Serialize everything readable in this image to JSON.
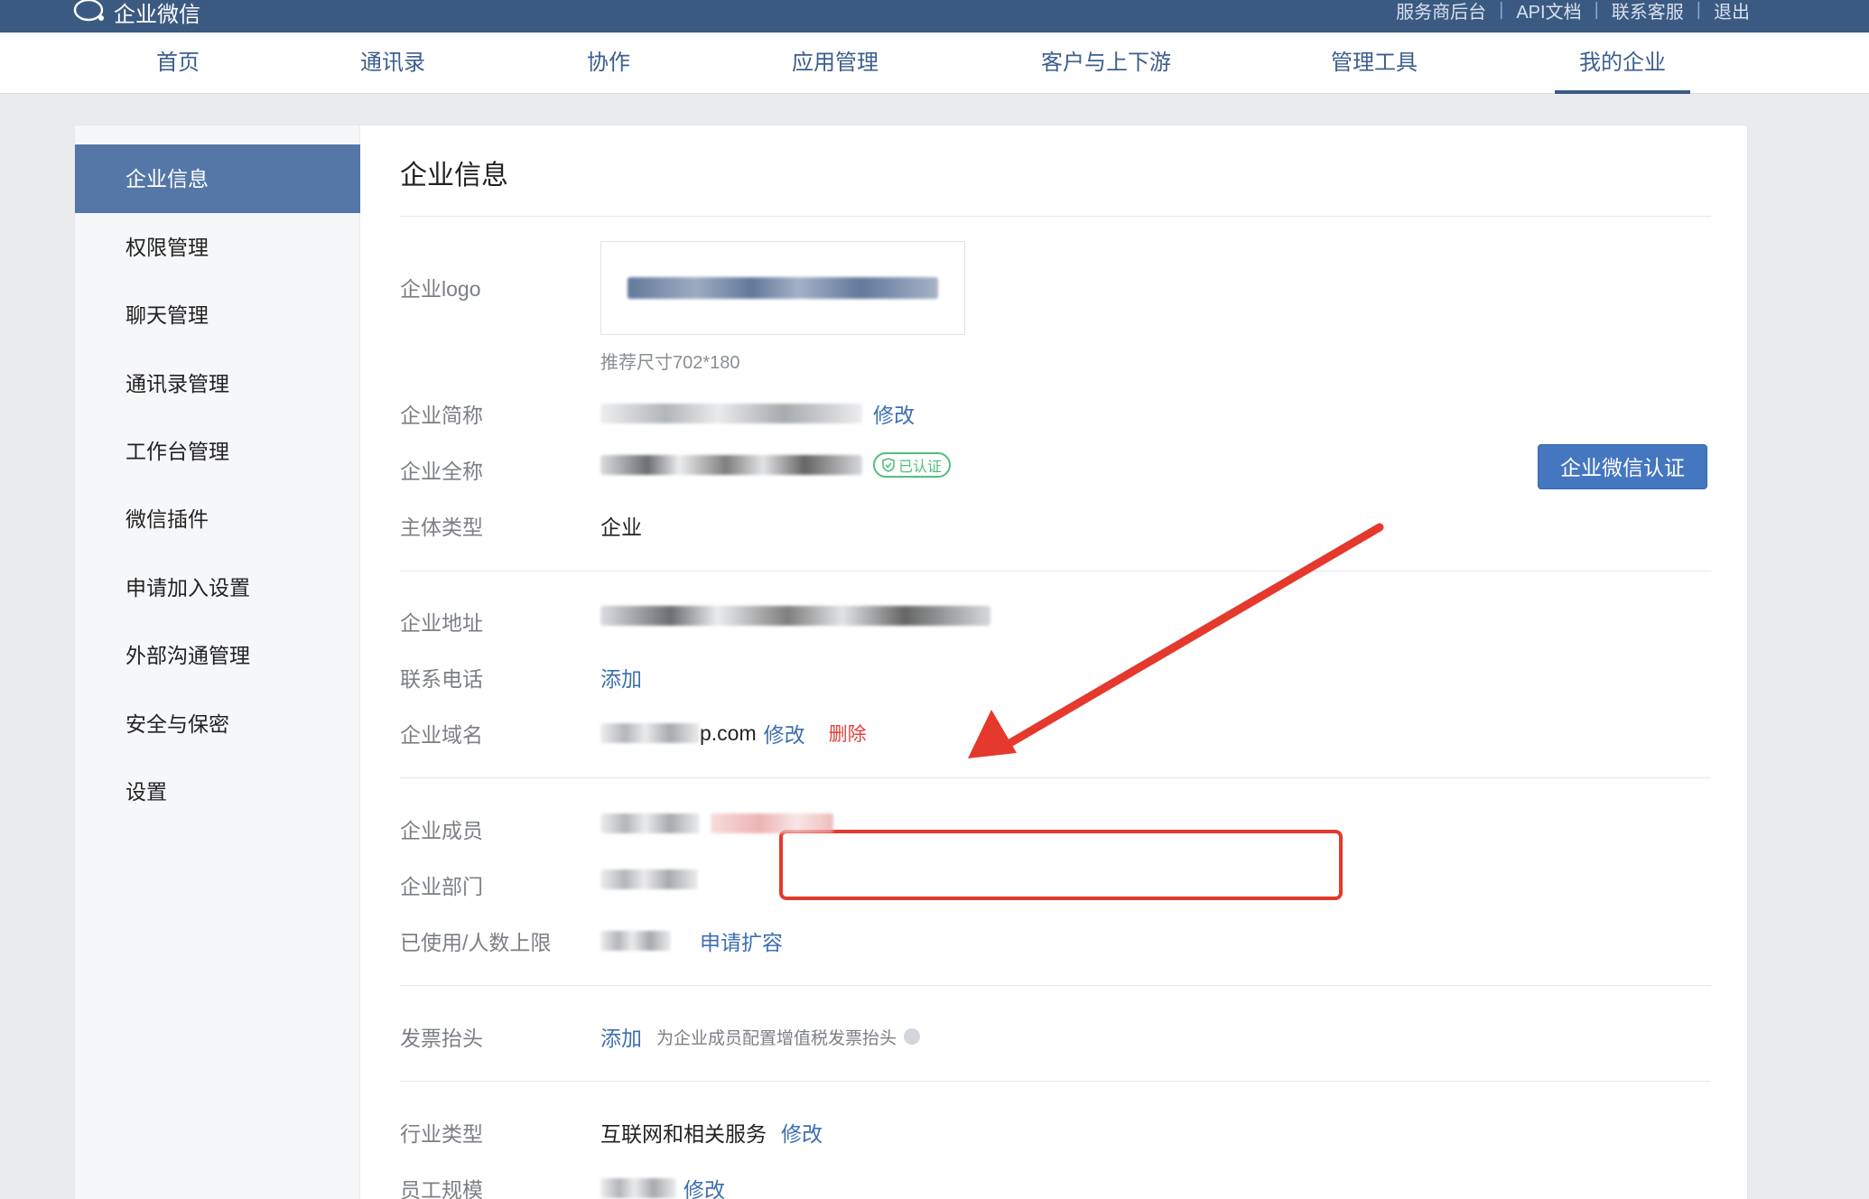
{
  "topbar": {
    "brand": "企业微信",
    "links": [
      "服务商后台",
      "API文档",
      "联系客服",
      "退出"
    ],
    "separator": "|"
  },
  "nav": {
    "items": [
      "首页",
      "通讯录",
      "协作",
      "应用管理",
      "客户与上下游",
      "管理工具",
      "我的企业"
    ],
    "active": "我的企业"
  },
  "sidebar": {
    "items": [
      "企业信息",
      "权限管理",
      "聊天管理",
      "通讯录管理",
      "工作台管理",
      "微信插件",
      "申请加入设置",
      "外部沟通管理",
      "安全与保密",
      "设置"
    ],
    "active": "企业信息"
  },
  "content": {
    "title": "企业信息",
    "logo_label": "企业logo",
    "logo_hint": "推荐尺寸702*180",
    "short_name_label": "企业简称",
    "short_name_action": "修改",
    "full_name_label": "企业全称",
    "verified_badge": "已认证",
    "cert_button": "企业微信认证",
    "entity_type_label": "主体类型",
    "entity_type_value": "企业",
    "address_label": "企业地址",
    "phone_label": "联系电话",
    "phone_action": "添加",
    "domain_label": "企业域名",
    "domain_value_suffix": "p.com",
    "domain_edit": "修改",
    "domain_delete": "删除",
    "members_label": "企业成员",
    "departments_label": "企业部门",
    "usage_label": "已使用/人数上限",
    "usage_action": "申请扩容",
    "invoice_label": "发票抬头",
    "invoice_action": "添加",
    "invoice_hint": "为企业成员配置增值税发票抬头",
    "industry_label": "行业类型",
    "industry_value": "互联网和相关服务",
    "industry_action": "修改",
    "staff_size_label": "员工规模",
    "staff_size_action": "修改"
  },
  "colors": {
    "topbar": "#3b5a82",
    "active_side": "#5577a8",
    "link": "#3d6fb0",
    "annotation": "#e4392c",
    "verified": "#4fbf7d"
  }
}
